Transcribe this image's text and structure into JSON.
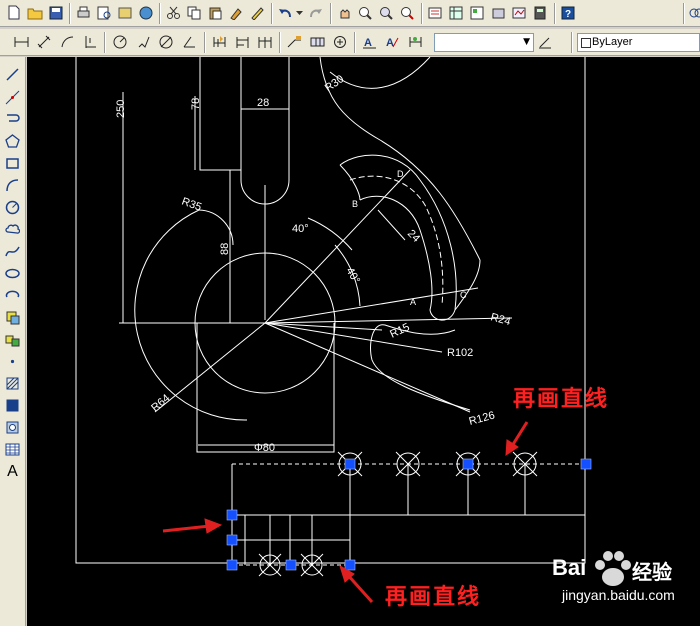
{
  "toolbar": {
    "layer_value": "ByLayer"
  },
  "left_toolbar": {
    "text_tool_label": "A"
  },
  "drawing": {
    "dimensions": {
      "d250": "250",
      "d78": "78",
      "d28": "28",
      "r30": "R30",
      "r35": "R35",
      "d88": "88",
      "a40a": "40°",
      "a40b": "40°",
      "d24": "24",
      "r15": "R15",
      "r24": "R24",
      "r102": "R102",
      "r64": "R64",
      "r126": "R126",
      "phi80": "Φ80"
    },
    "points": {
      "a": "A",
      "b": "B",
      "c": "C",
      "d": "D"
    }
  },
  "annotations": {
    "top": "再画直线",
    "bottom": "再画直线",
    "arrow_color": "#e02020"
  },
  "watermark": {
    "brand_left": "Bai",
    "brand_right": "经验",
    "url": "jingyan.baidu.com"
  },
  "colors": {
    "canvas_bg": "#000000",
    "line": "#ffffff",
    "grip": "#1450ff",
    "annotation": "#ff2020"
  }
}
